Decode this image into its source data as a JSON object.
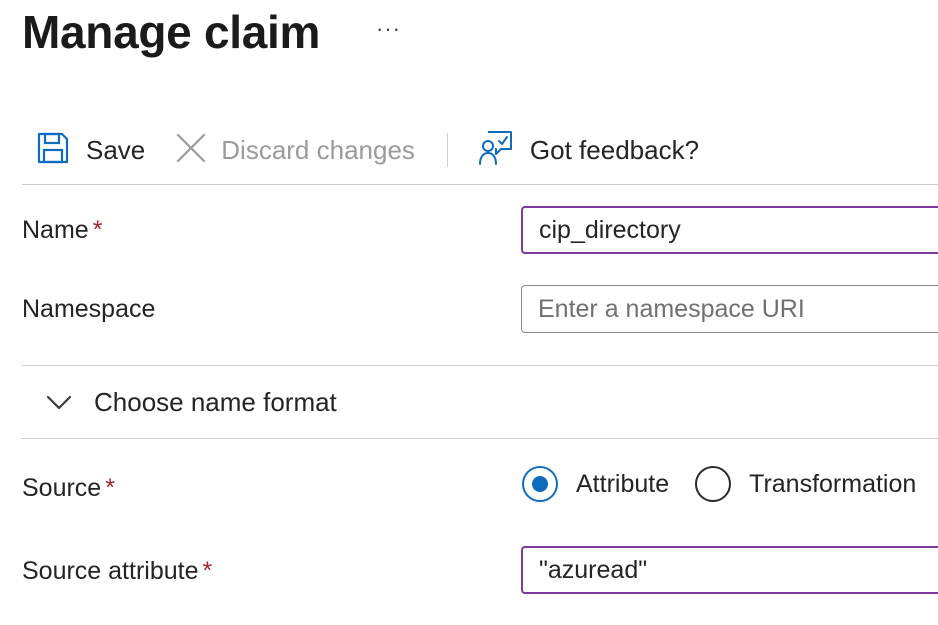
{
  "header": {
    "title": "Manage claim",
    "more_label": "···"
  },
  "toolbar": {
    "save_label": "Save",
    "discard_label": "Discard changes",
    "feedback_label": "Got feedback?"
  },
  "form": {
    "name": {
      "label": "Name",
      "required_marker": "*",
      "value": "cip_directory"
    },
    "namespace": {
      "label": "Namespace",
      "placeholder": "Enter a namespace URI",
      "value": ""
    },
    "name_format": {
      "label": "Choose name format",
      "expanded": false
    },
    "source": {
      "label": "Source",
      "required_marker": "*",
      "options": [
        "Attribute",
        "Transformation"
      ],
      "selected": "Attribute"
    },
    "source_attribute": {
      "label": "Source attribute",
      "required_marker": "*",
      "value": "\"azuread\""
    }
  },
  "colors": {
    "accent_focus": "#7e3aa1",
    "radio_selected": "#0f6cbd",
    "icon_blue": "#0f6cbd",
    "required": "#a4262c"
  },
  "icons": {
    "save": "save-icon",
    "discard": "close-icon",
    "feedback": "feedback-icon",
    "collapse": "chevron-down-icon"
  }
}
